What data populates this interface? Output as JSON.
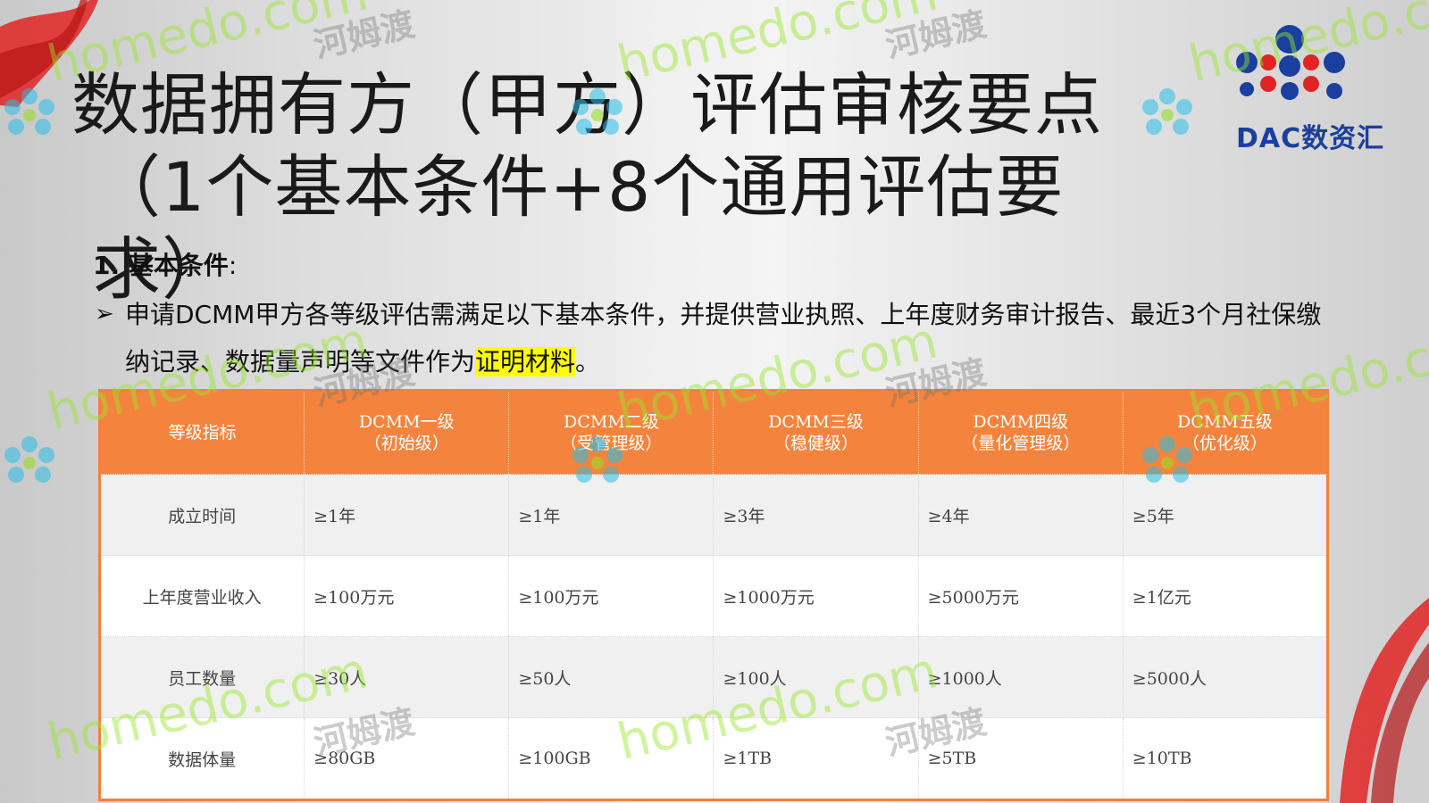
{
  "title": {
    "line1": "数据拥有方（甲方）评估审核要点",
    "line2": "（1个基本条件+8个通用评估要求）"
  },
  "logo": {
    "text": "DAC数资汇"
  },
  "section": {
    "number": "1.",
    "heading": "基本条件",
    "colon": ":"
  },
  "paragraph": {
    "bullet": "➢",
    "text_before": "申请DCMM甲方各等级评估需满足以下基本条件，并提供营业执照、上年度财务审计报告、最近3个月社保缴纳记录、数据量声明等文件作为",
    "highlight": "证明材料",
    "text_after": "。"
  },
  "table": {
    "corner": "等级指标",
    "headers": [
      {
        "name": "DCMM一级",
        "sub": "（初始级）"
      },
      {
        "name": "DCMM二级",
        "sub": "（受管理级）"
      },
      {
        "name": "DCMM三级",
        "sub": "（稳健级）"
      },
      {
        "name": "DCMM四级",
        "sub": "（量化管理级）"
      },
      {
        "name": "DCMM五级",
        "sub": "（优化级）"
      }
    ],
    "rows": [
      {
        "label": "成立时间",
        "values": [
          "≥1年",
          "≥1年",
          "≥3年",
          "≥4年",
          "≥5年"
        ]
      },
      {
        "label": "上年度营业收入",
        "values": [
          "≥100万元",
          "≥100万元",
          "≥1000万元",
          "≥5000万元",
          "≥1亿元"
        ]
      },
      {
        "label": "员工数量",
        "values": [
          "≥30人",
          "≥50人",
          "≥100人",
          "≥1000人",
          "≥5000人"
        ]
      },
      {
        "label": "数据体量",
        "values": [
          "≥80GB",
          "≥100GB",
          "≥1TB",
          "≥5TB",
          "≥10TB"
        ]
      }
    ],
    "colors": {
      "header_bg": "#f4843d",
      "border": "#f4813a",
      "odd_row": "#f0f0f0"
    }
  },
  "watermark": {
    "latin": "homedo.com",
    "cn": "河姆渡"
  }
}
